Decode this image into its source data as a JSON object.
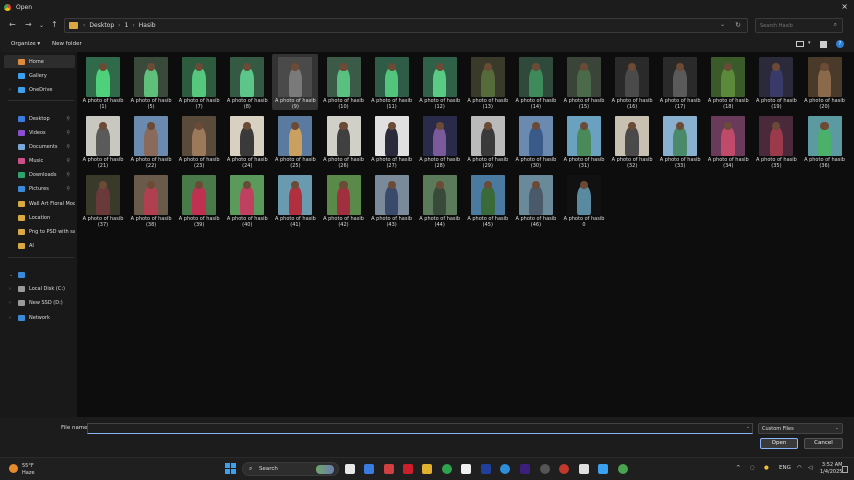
{
  "window": {
    "title": "Open",
    "close_icon": "×"
  },
  "nav": {
    "breadcrumb": [
      "Desktop",
      "1",
      "Hasib"
    ],
    "search_placeholder": "Search Hasib"
  },
  "command_bar": {
    "organize": "Organize ▾",
    "new_folder": "New folder"
  },
  "sidebar": {
    "quick": [
      {
        "label": "Home",
        "icon": "home-icon",
        "color": "#e08a3c",
        "selected": true
      },
      {
        "label": "Gallery",
        "icon": "gallery-icon",
        "color": "#3aa0f0"
      },
      {
        "label": "OneDrive",
        "icon": "cloud-icon",
        "color": "#3aa0f0",
        "chev": true
      }
    ],
    "pinned": [
      {
        "label": "Desktop",
        "icon": "desktop-icon",
        "color": "#3a7be0",
        "pin": true
      },
      {
        "label": "Videos",
        "icon": "videos-icon",
        "color": "#8a4fd0",
        "pin": true
      },
      {
        "label": "Documents",
        "icon": "documents-icon",
        "color": "#7aa7d9",
        "pin": true
      },
      {
        "label": "Music",
        "icon": "music-icon",
        "color": "#d04f8a",
        "pin": true
      },
      {
        "label": "Downloads",
        "icon": "downloads-icon",
        "color": "#2fa36b",
        "pin": true
      },
      {
        "label": "Pictures",
        "icon": "pictures-icon",
        "color": "#3a8ad9",
        "pin": true
      },
      {
        "label": "Wall Art Floral Moc",
        "icon": "folder-icon",
        "color": "#d9a941"
      },
      {
        "label": "Location",
        "icon": "folder-icon",
        "color": "#d9a941"
      },
      {
        "label": "Png to PSD with sa",
        "icon": "folder-icon",
        "color": "#d9a941"
      },
      {
        "label": "AI",
        "icon": "folder-icon",
        "color": "#d9a941"
      }
    ],
    "devices": [
      {
        "label": "",
        "icon": "this-pc-icon",
        "color": "#3a8ad9",
        "expanded": true
      },
      {
        "label": "Local Disk (C:)",
        "icon": "drive-icon",
        "color": "#9a9a9a",
        "chev": true
      },
      {
        "label": "New SSD (D:)",
        "icon": "drive-icon",
        "color": "#9a9a9a",
        "chev": true
      },
      {
        "label": "Network",
        "icon": "network-icon",
        "color": "#3a8ad9",
        "chev": true
      }
    ]
  },
  "files": [
    {
      "l1": "A photo of hasib",
      "l2": "(1)"
    },
    {
      "l1": "A photo of hasib",
      "l2": "(5)"
    },
    {
      "l1": "A photo of hasib",
      "l2": "(7)"
    },
    {
      "l1": "A photo of hasib",
      "l2": "(8)"
    },
    {
      "l1": "A photo of hasib",
      "l2": "(9)",
      "selected": true
    },
    {
      "l1": "A photo of hasib",
      "l2": "(10)"
    },
    {
      "l1": "A photo of hasib",
      "l2": "(11)"
    },
    {
      "l1": "A photo of hasib",
      "l2": "(12)"
    },
    {
      "l1": "A photo of hasib",
      "l2": "(13)"
    },
    {
      "l1": "A photo of hasib",
      "l2": "(14)"
    },
    {
      "l1": "A photo of hasib",
      "l2": "(15)"
    },
    {
      "l1": "A photo of hasib",
      "l2": "(16)"
    },
    {
      "l1": "A photo of hasib",
      "l2": "(17)"
    },
    {
      "l1": "A photo of hasib",
      "l2": "(18)"
    },
    {
      "l1": "A photo of hasib",
      "l2": "(19)"
    },
    {
      "l1": "A photo of hasib",
      "l2": "(20)"
    },
    {
      "l1": "A photo of hasib",
      "l2": "(21)"
    },
    {
      "l1": "A photo of hasib",
      "l2": "(22)"
    },
    {
      "l1": "A photo of hasib",
      "l2": "(23)"
    },
    {
      "l1": "A photo of hasib",
      "l2": "(24)"
    },
    {
      "l1": "A photo of hasib",
      "l2": "(25)"
    },
    {
      "l1": "A photo of hasib",
      "l2": "(26)"
    },
    {
      "l1": "A photo of hasib",
      "l2": "(27)"
    },
    {
      "l1": "A photo of hasib",
      "l2": "(28)"
    },
    {
      "l1": "A photo of hasib",
      "l2": "(29)"
    },
    {
      "l1": "A photo of hasib",
      "l2": "(30)"
    },
    {
      "l1": "A photo of hasib",
      "l2": "(31)"
    },
    {
      "l1": "A photo of hasib",
      "l2": "(32)"
    },
    {
      "l1": "A photo of hasib",
      "l2": "(33)"
    },
    {
      "l1": "A photo of hasib",
      "l2": "(34)"
    },
    {
      "l1": "A photo of hasib",
      "l2": "(35)"
    },
    {
      "l1": "A photo of hasib",
      "l2": "(36)"
    },
    {
      "l1": "A photo of hasib",
      "l2": "(37)"
    },
    {
      "l1": "A photo of hasib",
      "l2": "(38)"
    },
    {
      "l1": "A photo of hasib",
      "l2": "(39)"
    },
    {
      "l1": "A photo of hasib",
      "l2": "(40)"
    },
    {
      "l1": "A photo of hasib",
      "l2": "(41)"
    },
    {
      "l1": "A photo of hasib",
      "l2": "(42)"
    },
    {
      "l1": "A photo of hasib",
      "l2": "(43)"
    },
    {
      "l1": "A photo of hasib",
      "l2": "(44)"
    },
    {
      "l1": "A photo of hasib",
      "l2": "(45)"
    },
    {
      "l1": "A photo of hasib",
      "l2": "(46)"
    },
    {
      "l1": "A photo of hasib",
      "l2": "0"
    }
  ],
  "footer": {
    "file_name_label": "File name:",
    "file_name_value": "",
    "file_type": "Custom Files",
    "open_label": "Open",
    "cancel_label": "Cancel"
  },
  "taskbar": {
    "weather_temp": "55°F",
    "weather_desc": "Haze",
    "search_label": "Search",
    "language": "ENG",
    "time": "3:52 AM",
    "date": "1/4/2025"
  }
}
